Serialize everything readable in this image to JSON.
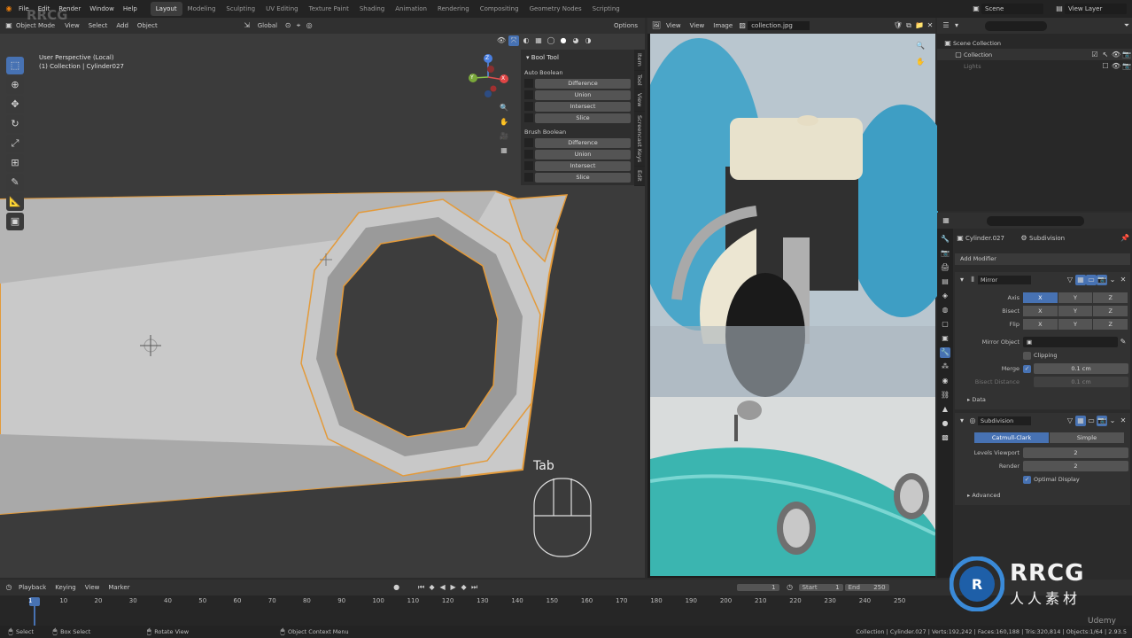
{
  "topbar": {
    "menus": [
      "File",
      "Edit",
      "Render",
      "Window",
      "Help"
    ],
    "workspaces": [
      "Layout",
      "Modeling",
      "Sculpting",
      "UV Editing",
      "Texture Paint",
      "Shading",
      "Animation",
      "Rendering",
      "Compositing",
      "Geometry Nodes",
      "Scripting"
    ],
    "active_workspace": "Layout",
    "scene_label": "Scene",
    "view_layer_label": "View Layer"
  },
  "viewport": {
    "mode": "Object Mode",
    "menus": [
      "View",
      "Select",
      "Add",
      "Object"
    ],
    "transform_orientation": "Global",
    "options_label": "Options",
    "overlay_title": "User Perspective (Local)",
    "overlay_subtitle": "(1) Collection | Cylinder027",
    "tab_hint": "Tab",
    "gizmo_axes": {
      "z": "Z",
      "y": "Y",
      "x": "X"
    }
  },
  "npanel": {
    "title": "Bool Tool",
    "auto_label": "Auto Boolean",
    "auto_ops": [
      "Difference",
      "Union",
      "Intersect",
      "Slice"
    ],
    "brush_label": "Brush Boolean",
    "brush_ops": [
      "Difference",
      "Union",
      "Intersect",
      "Slice"
    ],
    "tabs": [
      "Item",
      "Tool",
      "View",
      "Screencast Keys",
      "Edit"
    ]
  },
  "image_editor": {
    "menus": [
      "View",
      "View",
      "Image"
    ],
    "filename": "collection.jpg"
  },
  "outliner": {
    "scene_collection": "Scene Collection",
    "collection": "Collection",
    "child": "Lights"
  },
  "properties": {
    "object_name": "Cylinder.027",
    "modifier_context": "Subdivision",
    "add_modifier": "Add Modifier",
    "mirror": {
      "name": "Mirror",
      "axis_label": "Axis",
      "bisect_label": "Bisect",
      "flip_label": "Flip",
      "xyz": [
        "X",
        "Y",
        "Z"
      ],
      "mirror_object_label": "Mirror Object",
      "clipping_label": "Clipping",
      "merge_label": "Merge",
      "merge_value": "0.1 cm",
      "bisect_distance_label": "Bisect Distance",
      "bisect_distance_value": "0.1 cm",
      "data_label": "Data"
    },
    "subdivision": {
      "name": "Subdivision",
      "catmull": "Catmull-Clark",
      "simple": "Simple",
      "levels_viewport_label": "Levels Viewport",
      "levels_viewport": "2",
      "render_label": "Render",
      "render_value": "2",
      "optimal_display": "Optimal Display",
      "advanced_label": "Advanced"
    }
  },
  "timeline": {
    "menus": [
      "Playback",
      "Keying",
      "View",
      "Marker"
    ],
    "current_frame": "1",
    "start_label": "Start",
    "start": "1",
    "end_label": "End",
    "end": "250",
    "ticks": [
      "1",
      "10",
      "20",
      "30",
      "40",
      "50",
      "60",
      "70",
      "80",
      "90",
      "100",
      "110",
      "120",
      "130",
      "140",
      "150",
      "160",
      "170",
      "180",
      "190",
      "200",
      "210",
      "220",
      "230",
      "240",
      "250"
    ]
  },
  "statusbar": {
    "select": "Select",
    "box_select": "Box Select",
    "rotate_view": "Rotate View",
    "context_menu": "Object Context Menu",
    "stats": "Collection | Cylinder.027 | Verts:192,242 | Faces:160,188 | Tris:320,814 | Objects:1/64 | 2.93.5"
  },
  "branding": {
    "logo_main": "RRCG",
    "logo_sub": "人人素材",
    "udemy": "Udemy",
    "watermark": "RRCG"
  },
  "colors": {
    "accent": "#4772b3",
    "selection_outline": "#e39a3a",
    "background": "#2b2b2b"
  }
}
